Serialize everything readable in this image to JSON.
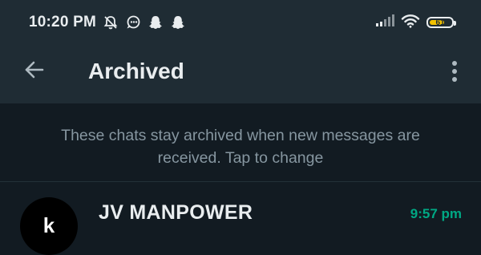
{
  "status_bar": {
    "time": "10:20 PM",
    "left_icons": [
      "bell-off-icon",
      "chat-bubble-icon",
      "snapchat-icon",
      "snapchat-icon"
    ],
    "right_icons": [
      "signal-icon",
      "wifi-icon",
      "battery-icon"
    ],
    "battery_level": "61"
  },
  "appbar": {
    "back_icon": "arrow-left-icon",
    "title": "Archived",
    "menu_icon": "more-vert-icon"
  },
  "archive_info": {
    "line1": "These chats stay archived when new messages are",
    "line2": "received. Tap to change"
  },
  "chats": [
    {
      "name": "JV MANPOWER",
      "time": "9:57 pm",
      "avatar_letter": "k"
    }
  ],
  "colors": {
    "background": "#121b22",
    "appbar": "#1f2c34",
    "accent_time": "#00a884",
    "muted_text": "#8696a0",
    "battery_fill": "#f2c200"
  }
}
